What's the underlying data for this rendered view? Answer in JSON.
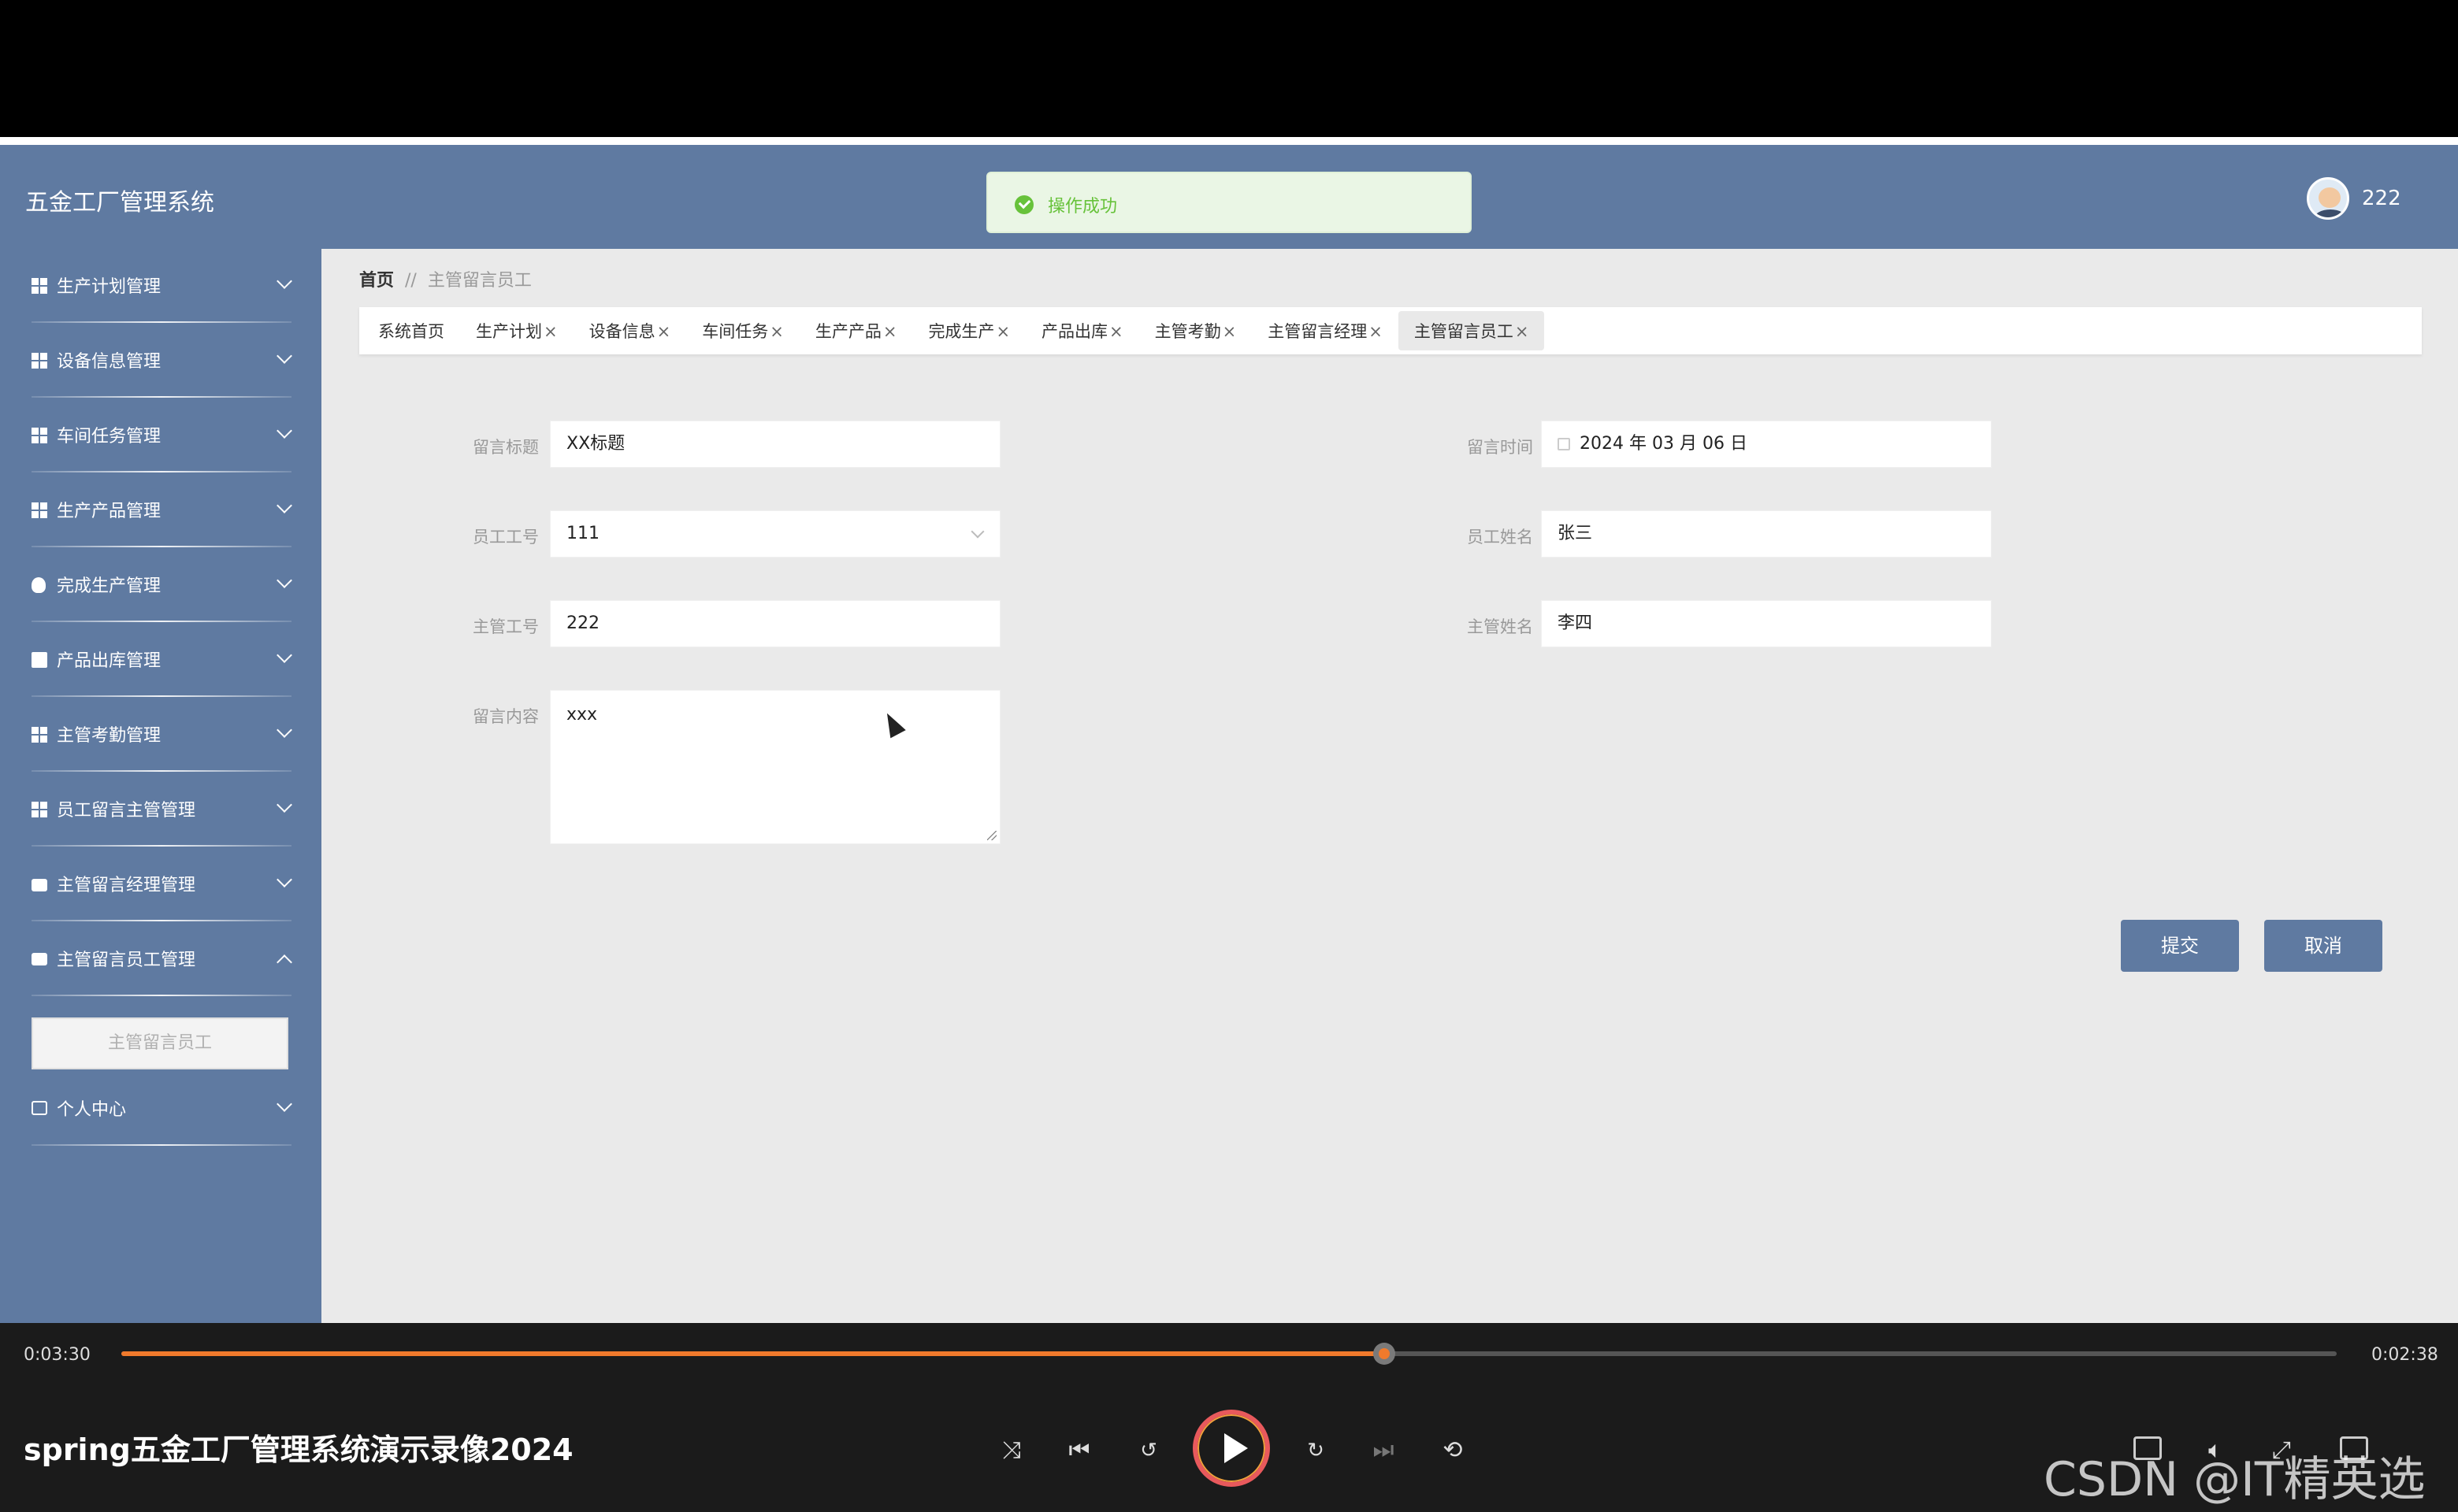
{
  "app": {
    "brand": "五金工厂管理系统",
    "toast": "操作成功",
    "user": "222"
  },
  "sidebar": {
    "items": [
      {
        "label": "生产计划管理",
        "icon": "grid-icon"
      },
      {
        "label": "设备信息管理",
        "icon": "grid-icon"
      },
      {
        "label": "车间任务管理",
        "icon": "grid-icon"
      },
      {
        "label": "生产产品管理",
        "icon": "grid-icon"
      },
      {
        "label": "完成生产管理",
        "icon": "lightbulb-icon"
      },
      {
        "label": "产品出库管理",
        "icon": "clipboard-icon"
      },
      {
        "label": "主管考勤管理",
        "icon": "grid-icon"
      },
      {
        "label": "员工留言主管管理",
        "icon": "grid-icon"
      },
      {
        "label": "主管留言经理管理",
        "icon": "briefcase-icon"
      },
      {
        "label": "主管留言员工管理",
        "icon": "chat-icon"
      },
      {
        "label": "个人中心",
        "icon": "card-icon"
      }
    ],
    "submenu": "主管留言员工"
  },
  "breadcrumb": {
    "home": "首页",
    "separator": "//",
    "current": "主管留言员工"
  },
  "tabs": [
    {
      "label": "系统首页",
      "closable": false
    },
    {
      "label": "生产计划",
      "closable": true
    },
    {
      "label": "设备信息",
      "closable": true
    },
    {
      "label": "车间任务",
      "closable": true
    },
    {
      "label": "生产产品",
      "closable": true
    },
    {
      "label": "完成生产",
      "closable": true
    },
    {
      "label": "产品出库",
      "closable": true
    },
    {
      "label": "主管考勤",
      "closable": true
    },
    {
      "label": "主管留言经理",
      "closable": true
    },
    {
      "label": "主管留言员工",
      "closable": true
    }
  ],
  "tab_close": "×",
  "form": {
    "title_label": "留言标题",
    "title_value": "XX标题",
    "time_label": "留言时间",
    "time_value": "2024 年 03 月 06 日",
    "emp_no_label": "员工工号",
    "emp_no_value": "111",
    "emp_name_label": "员工姓名",
    "emp_name_value": "张三",
    "mgr_no_label": "主管工号",
    "mgr_no_value": "222",
    "mgr_name_label": "主管姓名",
    "mgr_name_value": "李四",
    "content_label": "留言内容",
    "content_value": "xxx",
    "submit": "提交",
    "cancel": "取消"
  },
  "player": {
    "elapsed": "0:03:30",
    "remaining": "0:02:38",
    "progress": 0.57,
    "title": "spring五金工厂管理系统演示录像2024",
    "watermark": "CSDN @IT精英选手"
  },
  "colors": {
    "primary": "#5f7aa1",
    "success": "#67c23a",
    "progress": "#f07a2c"
  }
}
